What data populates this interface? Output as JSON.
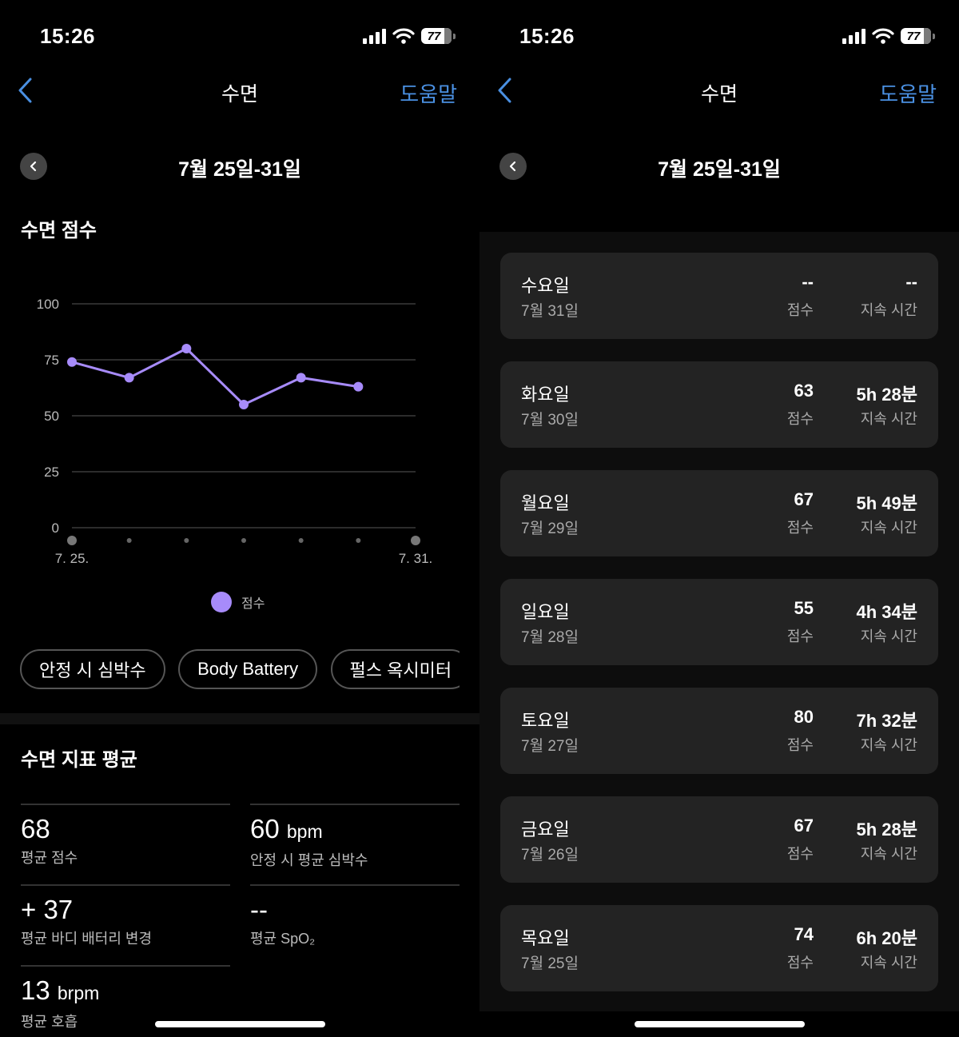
{
  "status_bar": {
    "time": "15:26",
    "battery": "77"
  },
  "nav": {
    "title": "수면",
    "help_label": "도움말"
  },
  "period": {
    "label": "7월 25일-31일"
  },
  "left": {
    "chart_section_title": "수면 점수",
    "chips": [
      "안정 시 심박수",
      "Body Battery",
      "펄스 옥시미터"
    ],
    "metrics_title": "수면 지표 평균",
    "metrics": [
      {
        "value": "68",
        "unit": "",
        "label": "평균 점수"
      },
      {
        "value": "60",
        "unit": "bpm",
        "label": "안정 시 평균 심박수"
      },
      {
        "value": "+ 37",
        "unit": "",
        "label": "평균 바디 배터리 변경"
      },
      {
        "value": "--",
        "unit": "",
        "label": "평균 SpO₂"
      },
      {
        "value": "13",
        "unit": "brpm",
        "label": "평균 호흡"
      }
    ]
  },
  "chart_data": {
    "type": "line",
    "title": "수면 점수",
    "xlabel": "",
    "ylabel": "",
    "x": [
      "7. 25.",
      "7. 26.",
      "7. 27.",
      "7. 28.",
      "7. 29.",
      "7. 30.",
      "7. 31."
    ],
    "x_tick_labels_shown": [
      "7. 25.",
      "7. 31."
    ],
    "yticks": [
      0,
      25,
      50,
      75,
      100
    ],
    "ylim": [
      0,
      100
    ],
    "grid": true,
    "legend": "bottom-center",
    "series": [
      {
        "name": "점수",
        "color": "#a78bfa",
        "values": [
          74,
          67,
          80,
          55,
          67,
          63,
          null
        ]
      }
    ]
  },
  "right": {
    "score_label": "점수",
    "duration_label": "지속 시간",
    "days": [
      {
        "weekday": "수요일",
        "date": "7월 31일",
        "score": "--",
        "duration": "--"
      },
      {
        "weekday": "화요일",
        "date": "7월 30일",
        "score": "63",
        "duration": "5h 28분"
      },
      {
        "weekday": "월요일",
        "date": "7월 29일",
        "score": "67",
        "duration": "5h 49분"
      },
      {
        "weekday": "일요일",
        "date": "7월 28일",
        "score": "55",
        "duration": "4h 34분"
      },
      {
        "weekday": "토요일",
        "date": "7월 27일",
        "score": "80",
        "duration": "7h 32분"
      },
      {
        "weekday": "금요일",
        "date": "7월 26일",
        "score": "67",
        "duration": "5h 28분"
      },
      {
        "weekday": "목요일",
        "date": "7월 25일",
        "score": "74",
        "duration": "6h 20분"
      }
    ]
  }
}
